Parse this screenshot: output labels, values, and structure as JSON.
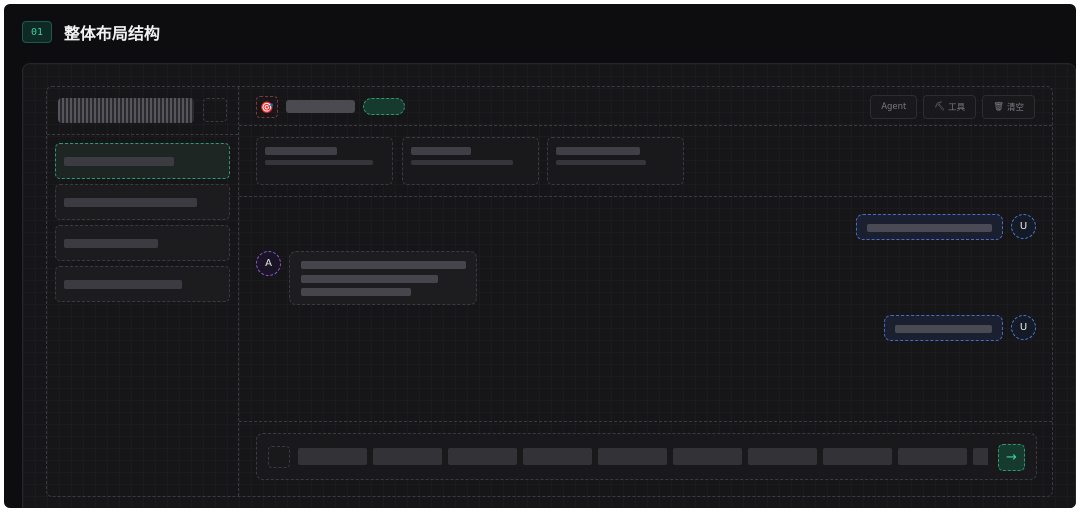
{
  "section": {
    "number": "01",
    "title": "整体布局结构"
  },
  "sidebar": {
    "items": [
      {
        "active": true
      },
      {
        "active": false
      },
      {
        "active": false
      },
      {
        "active": false
      }
    ]
  },
  "topbar": {
    "app_icon": "🎯",
    "actions": [
      {
        "label": "Agent",
        "icon": ""
      },
      {
        "label": "工具",
        "icon": "hammer-icon"
      },
      {
        "label": "清空",
        "icon": "trash-icon"
      }
    ]
  },
  "chat": {
    "user_initial": "U",
    "agent_initial": "A"
  },
  "composer": {
    "send_glyph": "→"
  },
  "colors": {
    "accent": "#3ecf9a",
    "user": "#4a7ad8",
    "agent": "#8a5ad8",
    "background": "#0d0d0f"
  }
}
